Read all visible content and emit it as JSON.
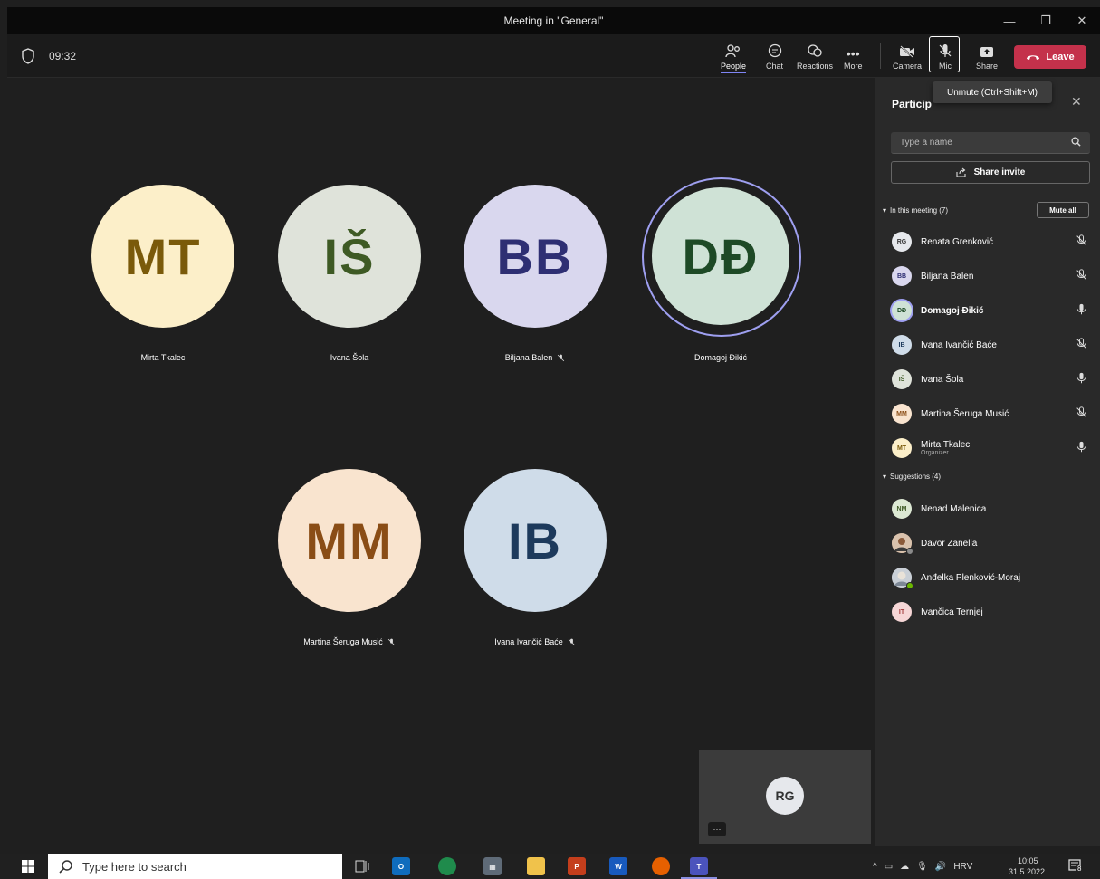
{
  "window": {
    "title": "Meeting in \"General\"",
    "minimize": "—",
    "restore": "❐",
    "close": "✕"
  },
  "toolbar": {
    "timer": "09:32",
    "people_label": "People",
    "chat_label": "Chat",
    "reactions_label": "Reactions",
    "more_label": "More",
    "camera_label": "Camera",
    "mic_label": "Mic",
    "share_label": "Share",
    "leave_label": "Leave"
  },
  "tooltip": "Unmute (Ctrl+Shift+M)",
  "stage": {
    "tiles": [
      {
        "initials": "MT",
        "name": "Mirta Tkalec",
        "muted": false,
        "bg": "#fcefc9",
        "fg": "#7a5a0a"
      },
      {
        "initials": "IŠ",
        "name": "Ivana Šola",
        "muted": false,
        "bg": "#dfe3da",
        "fg": "#3e5a24"
      },
      {
        "initials": "BB",
        "name": "Biljana Balen",
        "muted": true,
        "bg": "#d9d7ee",
        "fg": "#2e2f73"
      },
      {
        "initials": "DĐ",
        "name": "Domagoj Đikić",
        "muted": false,
        "bg": "#cfe2d6",
        "fg": "#1e4a26",
        "speaking": true
      },
      {
        "initials": "MM",
        "name": "Martina Šeruga Musić",
        "muted": true,
        "bg": "#f9e4cf",
        "fg": "#8a4d16"
      },
      {
        "initials": "IB",
        "name": "Ivana Ivančić Baće",
        "muted": true,
        "bg": "#cfdce9",
        "fg": "#1d3a5c"
      }
    ],
    "self_initials": "RG",
    "self_more": "···"
  },
  "panel": {
    "title": "Particip",
    "search_placeholder": "Type a name",
    "share_invite": "Share invite",
    "in_meeting": "In this meeting (7)",
    "mute_all": "Mute all",
    "participants": [
      {
        "initials": "RG",
        "name": "Renata Grenković",
        "sub": "",
        "mic": "muted",
        "bg": "#e6e8ec",
        "fg": "#333"
      },
      {
        "initials": "BB",
        "name": "Biljana Balen",
        "sub": "",
        "mic": "muted",
        "bg": "#d9d7ee",
        "fg": "#2e2f73"
      },
      {
        "initials": "DĐ",
        "name": "Domagoj Đikić",
        "sub": "",
        "mic": "on",
        "bg": "#cfe2d6",
        "fg": "#1e4a26"
      },
      {
        "initials": "IB",
        "name": "Ivana Ivančić Baće",
        "sub": "",
        "mic": "muted",
        "bg": "#cfdce9",
        "fg": "#1d3a5c"
      },
      {
        "initials": "IŠ",
        "name": "Ivana Šola",
        "sub": "",
        "mic": "on",
        "bg": "#dfe3da",
        "fg": "#3e5a24"
      },
      {
        "initials": "MM",
        "name": "Martina Šeruga Musić",
        "sub": "",
        "mic": "muted",
        "bg": "#f9e4cf",
        "fg": "#8a4d16"
      },
      {
        "initials": "MT",
        "name": "Mirta Tkalec",
        "sub": "Organizer",
        "mic": "on",
        "bg": "#fcefc9",
        "fg": "#7a5a0a"
      }
    ],
    "suggestions_label": "Suggestions (4)",
    "suggestions": [
      {
        "initials": "NM",
        "name": "Nenad Malenica",
        "bg": "#dce8d3",
        "fg": "#3e5a24"
      },
      {
        "initials": "",
        "name": "Davor Zanella",
        "bg": "#b58a6a",
        "fg": "#fff"
      },
      {
        "initials": "",
        "name": "Anđelka Plenković-Moraj",
        "bg": "#a8b0bb",
        "fg": "#fff"
      },
      {
        "initials": "IT",
        "name": "Ivančica Ternjej",
        "bg": "#f6d6d6",
        "fg": "#a33a3a"
      }
    ]
  },
  "taskbar": {
    "search_placeholder": "Type here to search",
    "language": "HRV",
    "time": "10:05",
    "date": "31.5.2022.",
    "notifications": "8"
  }
}
